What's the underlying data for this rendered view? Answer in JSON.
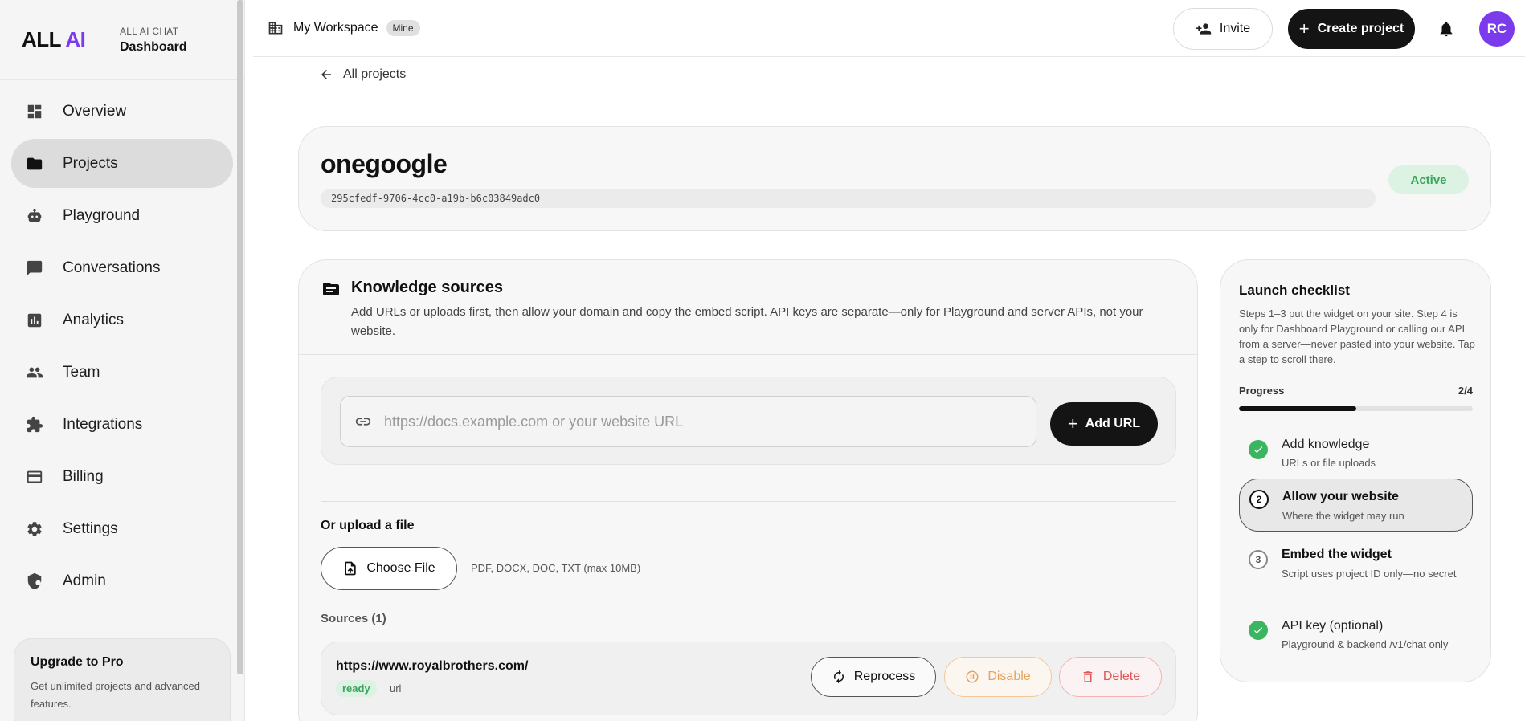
{
  "brand": {
    "logo_main": "ALL",
    "logo_accent": "AI",
    "subtitle": "ALL AI CHAT",
    "title": "Dashboard"
  },
  "sidebar": {
    "items": [
      {
        "label": "Overview",
        "icon": "dashboard-icon"
      },
      {
        "label": "Projects",
        "icon": "folder-icon",
        "active": true
      },
      {
        "label": "Playground",
        "icon": "robot-icon"
      },
      {
        "label": "Conversations",
        "icon": "chat-icon"
      },
      {
        "label": "Analytics",
        "icon": "analytics-icon"
      },
      {
        "label": "Team",
        "icon": "team-icon"
      },
      {
        "label": "Integrations",
        "icon": "puzzle-icon"
      },
      {
        "label": "Billing",
        "icon": "credit-card-icon"
      },
      {
        "label": "Settings",
        "icon": "gear-icon"
      },
      {
        "label": "Admin",
        "icon": "admin-shield-icon"
      }
    ],
    "upgrade": {
      "title": "Upgrade to Pro",
      "desc": "Get unlimited projects and advanced features."
    }
  },
  "header": {
    "workspace": "My Workspace",
    "workspace_badge": "Mine",
    "invite_label": "Invite",
    "create_label": "Create project",
    "avatar_initials": "RC"
  },
  "back_label": "All projects",
  "project": {
    "name": "onegoogle",
    "id": "295cfedf-9706-4cc0-a19b-b6c03849adc0",
    "status": "Active"
  },
  "knowledge": {
    "title": "Knowledge sources",
    "desc": "Add URLs or uploads first, then allow your domain and copy the embed script. API keys are separate—only for Playground and server APIs, not your website.",
    "url_placeholder": "https://docs.example.com or your website URL",
    "add_url_label": "Add URL",
    "upload_label": "Or upload a file",
    "choose_file_label": "Choose File",
    "upload_hint": "PDF, DOCX, DOC, TXT (max 10MB)",
    "sources_label": "Sources (1)",
    "sources": [
      {
        "url": "https://www.royalbrothers.com/",
        "status": "ready",
        "type": "url"
      }
    ],
    "reprocess_label": "Reprocess",
    "disable_label": "Disable",
    "delete_label": "Delete"
  },
  "checklist": {
    "title": "Launch checklist",
    "desc": "Steps 1–3 put the widget on your site. Step 4 is only for Dashboard Playground or calling our API from a server—never pasted into your website. Tap a step to scroll there.",
    "progress_label": "Progress",
    "progress_value": "2/4",
    "progress_fraction": 0.5,
    "steps": [
      {
        "number": "1",
        "title": "Add knowledge",
        "sub": "URLs or file uploads",
        "state": "done"
      },
      {
        "number": "2",
        "title": "Allow your website",
        "sub": "Where the widget may run",
        "state": "current"
      },
      {
        "number": "3",
        "title": "Embed the widget",
        "sub": "Script uses project ID only—no secret",
        "state": "todo"
      },
      {
        "number": "4",
        "title": "API key (optional)",
        "sub": "Playground & backend /v1/chat only",
        "state": "done"
      }
    ]
  },
  "colors": {
    "accent": "#7c3aed",
    "success": "#3ba55c",
    "warning": "#e8a25a",
    "danger": "#e05555"
  }
}
